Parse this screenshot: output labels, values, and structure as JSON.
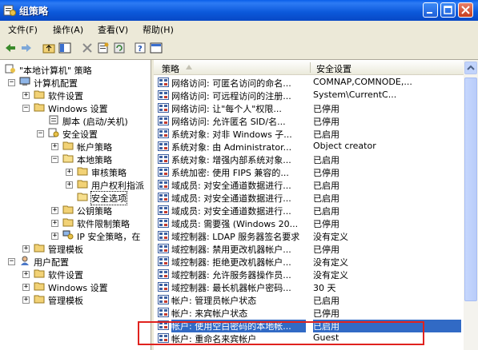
{
  "window": {
    "title": "组策略"
  },
  "menu": {
    "file": "文件(F)",
    "action": "操作(A)",
    "view": "查看(V)",
    "help": "帮助(H)"
  },
  "tree": {
    "root": "\"本地计算机\" 策略",
    "computer_config": "计算机配置",
    "software_settings": "软件设置",
    "windows_settings": "Windows 设置",
    "scripts": "脚本 (启动/关机)",
    "security_settings": "安全设置",
    "account_policies": "帐户策略",
    "local_policies": "本地策略",
    "audit_policy": "审核策略",
    "user_rights": "用户权利指派",
    "security_options": "安全选项",
    "public_key": "公钥策略",
    "software_restriction": "软件限制策略",
    "ip_security": "IP 安全策略，在",
    "admin_templates": "管理模板",
    "user_config": "用户配置",
    "user_software_settings": "软件设置",
    "user_windows_settings": "Windows 设置",
    "user_admin_templates": "管理模板"
  },
  "list": {
    "col_policy": "策略",
    "col_setting": "安全设置",
    "rows": [
      {
        "name": "网络访问: 可匿名访问的命名...",
        "value": "COMNAP,COMNODE,..."
      },
      {
        "name": "网络访问: 可远程访问的注册...",
        "value": "System\\CurrentC..."
      },
      {
        "name": "网络访问: 让\"每个人\"权限...",
        "value": "已停用"
      },
      {
        "name": "网络访问: 允许匿名 SID/名...",
        "value": "已停用"
      },
      {
        "name": "系统对象: 对非 Windows 子...",
        "value": "已启用"
      },
      {
        "name": "系统对象: 由 Administrator...",
        "value": "Object creator"
      },
      {
        "name": "系统对象: 增强内部系统对象...",
        "value": "已启用"
      },
      {
        "name": "系统加密: 使用 FIPS 兼容的...",
        "value": "已停用"
      },
      {
        "name": "域成员: 对安全通道数据进行...",
        "value": "已启用"
      },
      {
        "name": "域成员: 对安全通道数据进行...",
        "value": "已启用"
      },
      {
        "name": "域成员: 对安全通道数据进行...",
        "value": "已启用"
      },
      {
        "name": "域成员: 需要强 (Windows 20...",
        "value": "已停用"
      },
      {
        "name": "域控制器: LDAP 服务器签名要求",
        "value": "没有定义"
      },
      {
        "name": "域控制器: 禁用更改机器帐户...",
        "value": "已停用"
      },
      {
        "name": "域控制器: 拒绝更改机器帐户...",
        "value": "没有定义"
      },
      {
        "name": "域控制器: 允许服务器操作员...",
        "value": "没有定义"
      },
      {
        "name": "域控制器: 最长机器帐户密码...",
        "value": "30 天"
      },
      {
        "name": "帐户: 管理员帐户状态",
        "value": "已启用"
      },
      {
        "name": "帐户: 来宾帐户状态",
        "value": "已停用"
      },
      {
        "name": "帐户: 使用空白密码的本地帐...",
        "value": "已启用"
      },
      {
        "name": "帐户: 重命名来宾帐户",
        "value": "Guest"
      }
    ]
  },
  "colors": {
    "selection": "#316AC5",
    "highlight_border": "#E0221E",
    "titlebar": "#0B58DA"
  }
}
